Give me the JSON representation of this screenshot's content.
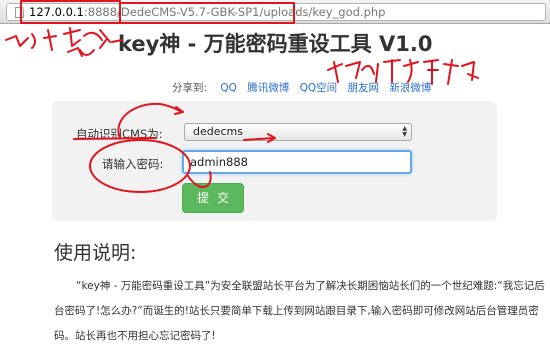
{
  "browser": {
    "url_host": "127.0.0.1",
    "url_rest": ":8888/DedeCMS-V5.7-GBK-SP1/uploads/key_god.php"
  },
  "page": {
    "title": "key神 - 万能密码重设工具 V1.0"
  },
  "share": {
    "label": "分享到:",
    "links": [
      "QQ",
      "腾讯微博",
      "QQ空间",
      "朋友网",
      "新浪微博"
    ]
  },
  "form": {
    "cms_label": "自动识别CMS为:",
    "cms_selected": "dedecms",
    "password_label": "请输入密码:",
    "password_value": "admin888",
    "submit_label": "提交"
  },
  "usage": {
    "heading": "使用说明:",
    "body": "“key神 - 万能密码重设工具”为安全联盟站长平台为了解决长期困恼站长们的一个世纪难题:“我忘记后台密码了!怎么办?”而诞生的!站长只要简单下载上传到网站跟目录下,输入密码即可修改网站后台管理员密码。站长再也不用担心忘记密码了!"
  },
  "annotation_color": "#e0141e"
}
